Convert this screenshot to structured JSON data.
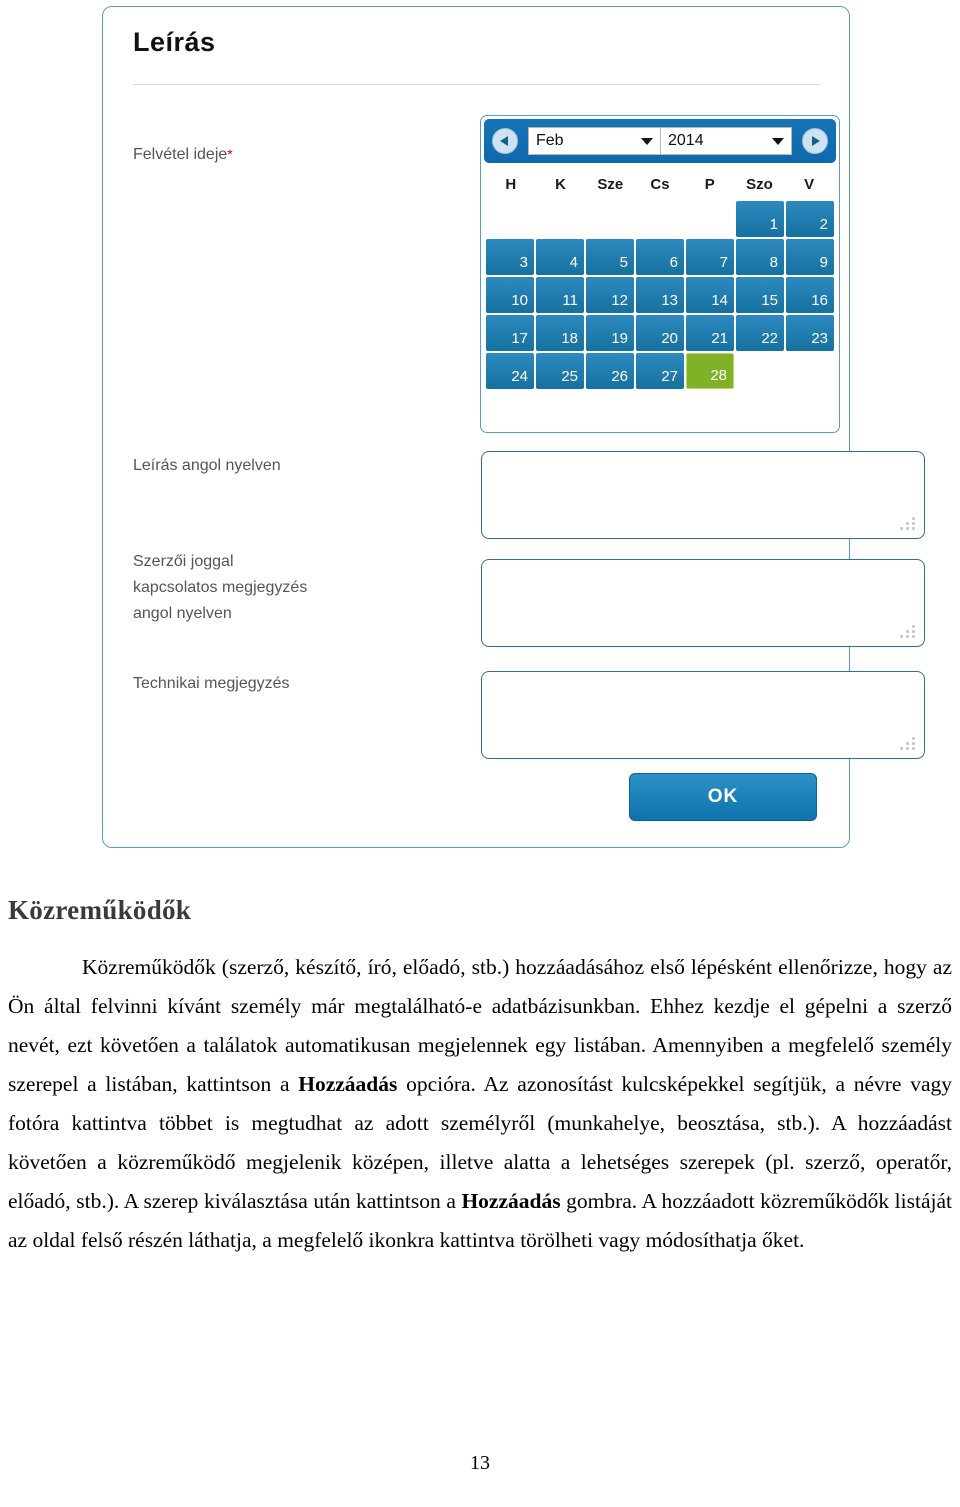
{
  "panel": {
    "title": "Leírás",
    "fields": {
      "date_label": "Felvétel ideje",
      "required_mark": "*",
      "desc_en_label": "Leírás angol nyelven",
      "copyright_note_label": "Szerzői joggal\nkapcsolatos megjegyzés\nangol nyelven",
      "technical_note_label": "Technikai megjegyzés"
    },
    "datepicker": {
      "prev_label": "◀",
      "next_label": "▶",
      "month": "Feb",
      "year": "2014",
      "dow": [
        "H",
        "K",
        "Sze",
        "Cs",
        "P",
        "Szo",
        "V"
      ],
      "leading_blanks": 5,
      "days": [
        1,
        2,
        3,
        4,
        5,
        6,
        7,
        8,
        9,
        10,
        11,
        12,
        13,
        14,
        15,
        16,
        17,
        18,
        19,
        20,
        21,
        22,
        23,
        24,
        25,
        26,
        27,
        28
      ],
      "selected_day": 28,
      "colors": {
        "header": "#1170b4",
        "day": "#2379ab",
        "selected": "#7fb227"
      }
    },
    "textareas": {
      "desc_en_value": "",
      "copyright_note_value": "",
      "technical_note_value": ""
    },
    "ok_button": "OK"
  },
  "document": {
    "heading": "Közreműködők",
    "paragraph_parts": {
      "p1": "Közreműködők (szerző, készítő, író, előadó, stb.) hozzáadásához első lépésként ellenőrizze, hogy az Ön által felvinni kívánt személy már megtalálható-e adatbázisunkban. Ehhez kezdje el gépelni a szerző nevét, ezt követően a találatok automatikusan megjelennek egy listában. Amennyiben a megfelelő személy szerepel a listában, kattintson a ",
      "bold1": "Hozzáadás",
      "p2": " opcióra. Az azonosítást kulcsképekkel segítjük, a névre vagy fotóra kattintva többet is megtudhat az adott személyről (munkahelye, beosztása, stb.). A hozzáadást követően a közreműködő megjelenik középen, illetve alatta a lehetséges szerepek (pl. szerző, operatőr, előadó, stb.). A szerep kiválasztása után kattintson a ",
      "bold2": "Hozzáadás",
      "p3": " gombra. A hozzáadott közreműködők listáját az oldal felső részén láthatja, a megfelelő ikonkra kattintva törölheti vagy módosíthatja őket."
    },
    "page_number": "13"
  }
}
